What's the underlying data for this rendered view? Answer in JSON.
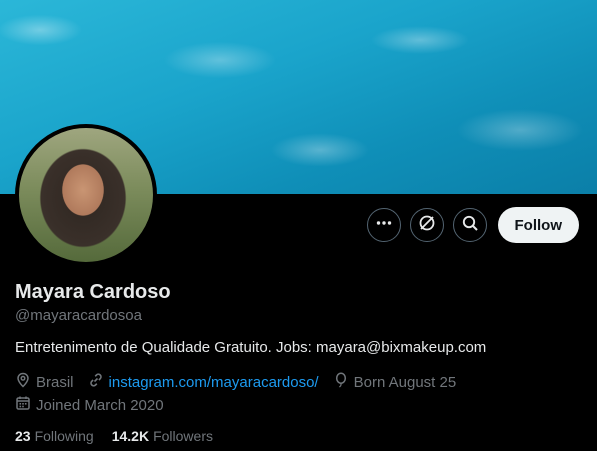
{
  "profile": {
    "name": "Mayara Cardoso",
    "handle": "@mayaracardosoa",
    "bio": "Entretenimento de Qualidade Gratuito. Jobs: mayara@bixmakeup.com",
    "location": "Brasil",
    "website": "instagram.com/mayaracardoso/",
    "birthday": "Born August 25",
    "joined": "Joined March 2020"
  },
  "stats": {
    "following_count": "23",
    "following_label": "Following",
    "followers_count": "14.2K",
    "followers_label": "Followers"
  },
  "actions": {
    "follow_label": "Follow",
    "icons": [
      "more-icon",
      "grok-icon",
      "search-icon"
    ]
  },
  "colors": {
    "background": "#000000",
    "link": "#1d9bf0",
    "muted": "#71767b",
    "follow_button_bg": "#eff3f4"
  }
}
